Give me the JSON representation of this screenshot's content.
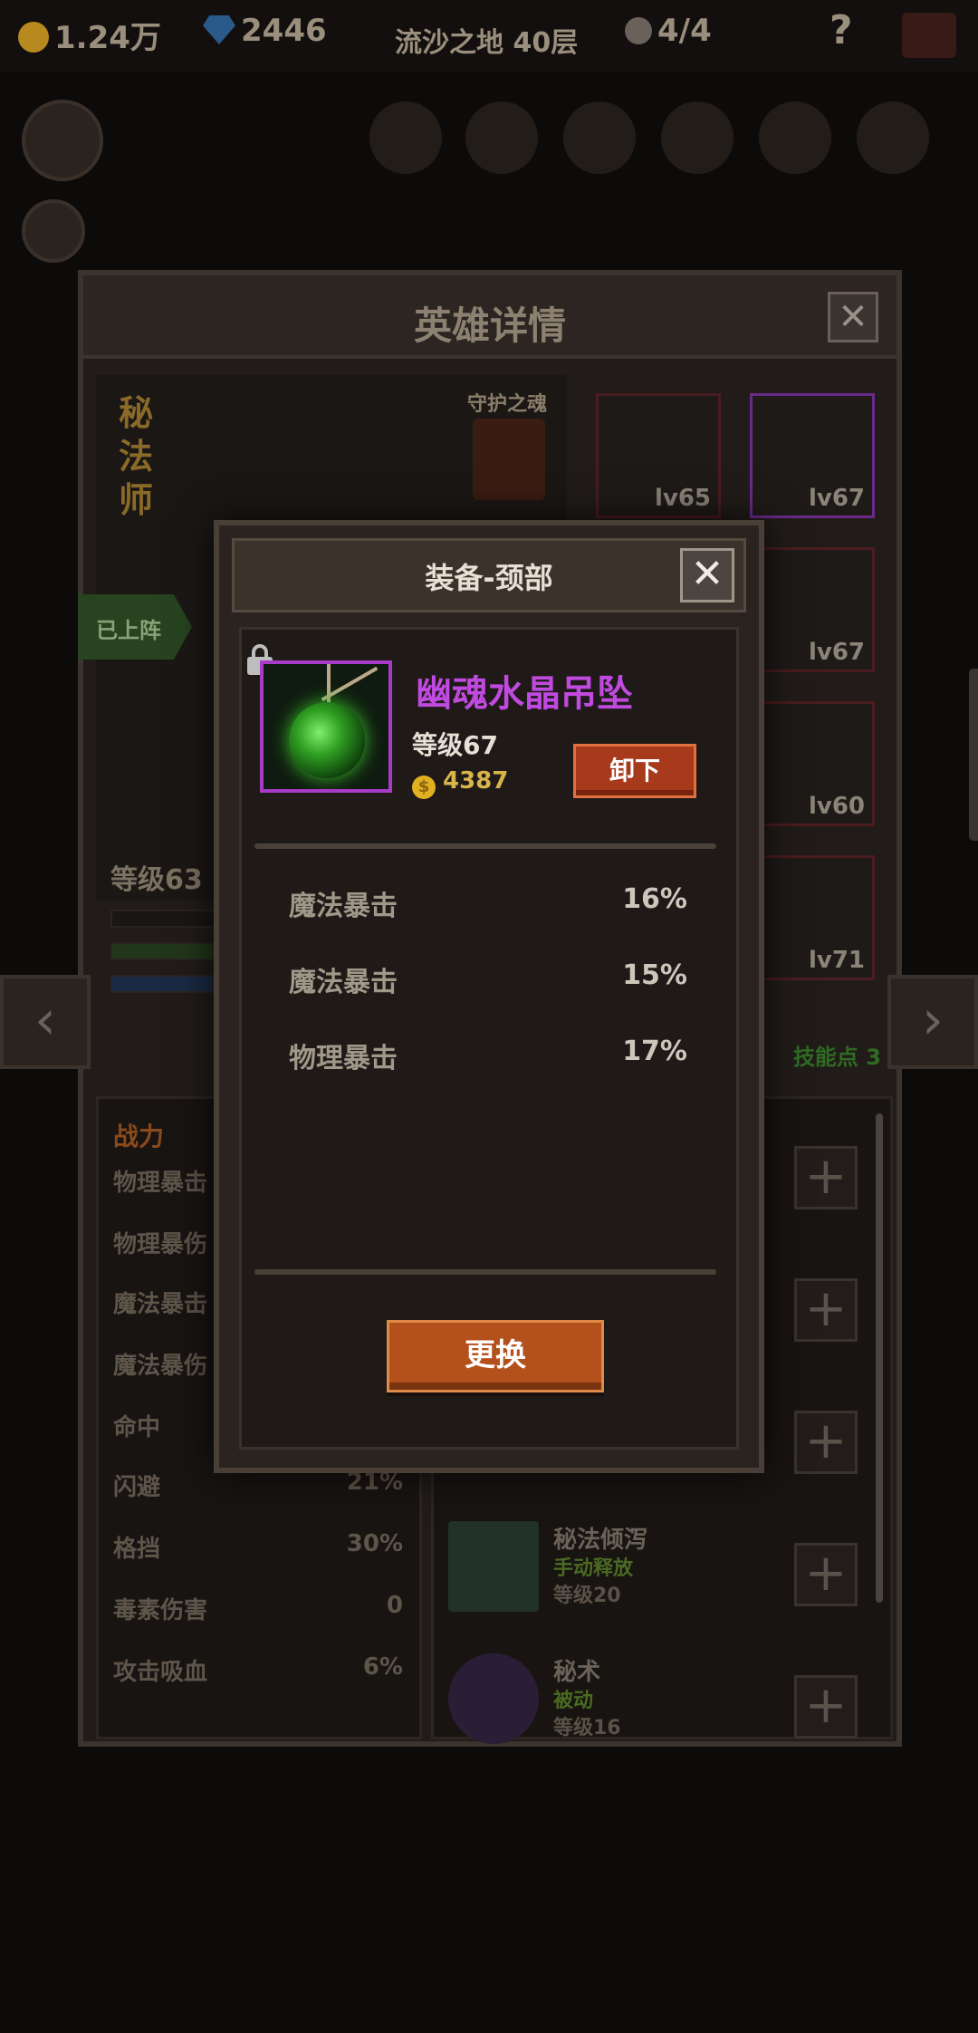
{
  "topbar": {
    "gold": "1.24万",
    "gems": "2446",
    "location": "流沙之地 40层",
    "keys": "4/4",
    "help": "?"
  },
  "hero_panel": {
    "title": "英雄详情",
    "close": "✕",
    "hero_class": "秘法师",
    "guard_label": "守护之魂",
    "deployed": "已上阵",
    "level": "等级63",
    "equipment": [
      {
        "lv": "lv65"
      },
      {
        "lv": "lv67"
      },
      {
        "lv": "lv67"
      },
      {
        "lv": "lv60"
      },
      {
        "lv": "lv71"
      }
    ],
    "stats_header": "战力",
    "stats": [
      {
        "label": "物理暴击",
        "value": ""
      },
      {
        "label": "物理暴伤",
        "value": ""
      },
      {
        "label": "魔法暴击",
        "value": ""
      },
      {
        "label": "魔法暴伤",
        "value": ""
      },
      {
        "label": "命中",
        "value": ""
      },
      {
        "label": "闪避",
        "value": "21%"
      },
      {
        "label": "格挡",
        "value": "30%"
      },
      {
        "label": "毒素伤害",
        "value": "0"
      },
      {
        "label": "攻击吸血",
        "value": "6%"
      }
    ],
    "skill_points": "技能点 3",
    "skills": [
      {
        "name": "秘法倾泻",
        "mode": "手动释放",
        "level": "等级20"
      },
      {
        "name": "秘术",
        "mode": "被动",
        "level": "等级16"
      }
    ],
    "plus": "+"
  },
  "modal": {
    "title": "装备-颈部",
    "close": "✕",
    "item_name": "幽魂水晶吊坠",
    "item_level": "等级67",
    "item_price": "4387",
    "coin_symbol": "$",
    "unequip_label": "卸下",
    "attributes": [
      {
        "name": "魔法暴击",
        "value": "16%"
      },
      {
        "name": "魔法暴击",
        "value": "15%"
      },
      {
        "name": "物理暴击",
        "value": "17%"
      }
    ],
    "replace_label": "更换"
  },
  "colors": {
    "item_rarity": "#c04ae0",
    "gold_text": "#d8b44a",
    "button_red": "#a83a1c",
    "button_orange": "#b4501c"
  }
}
